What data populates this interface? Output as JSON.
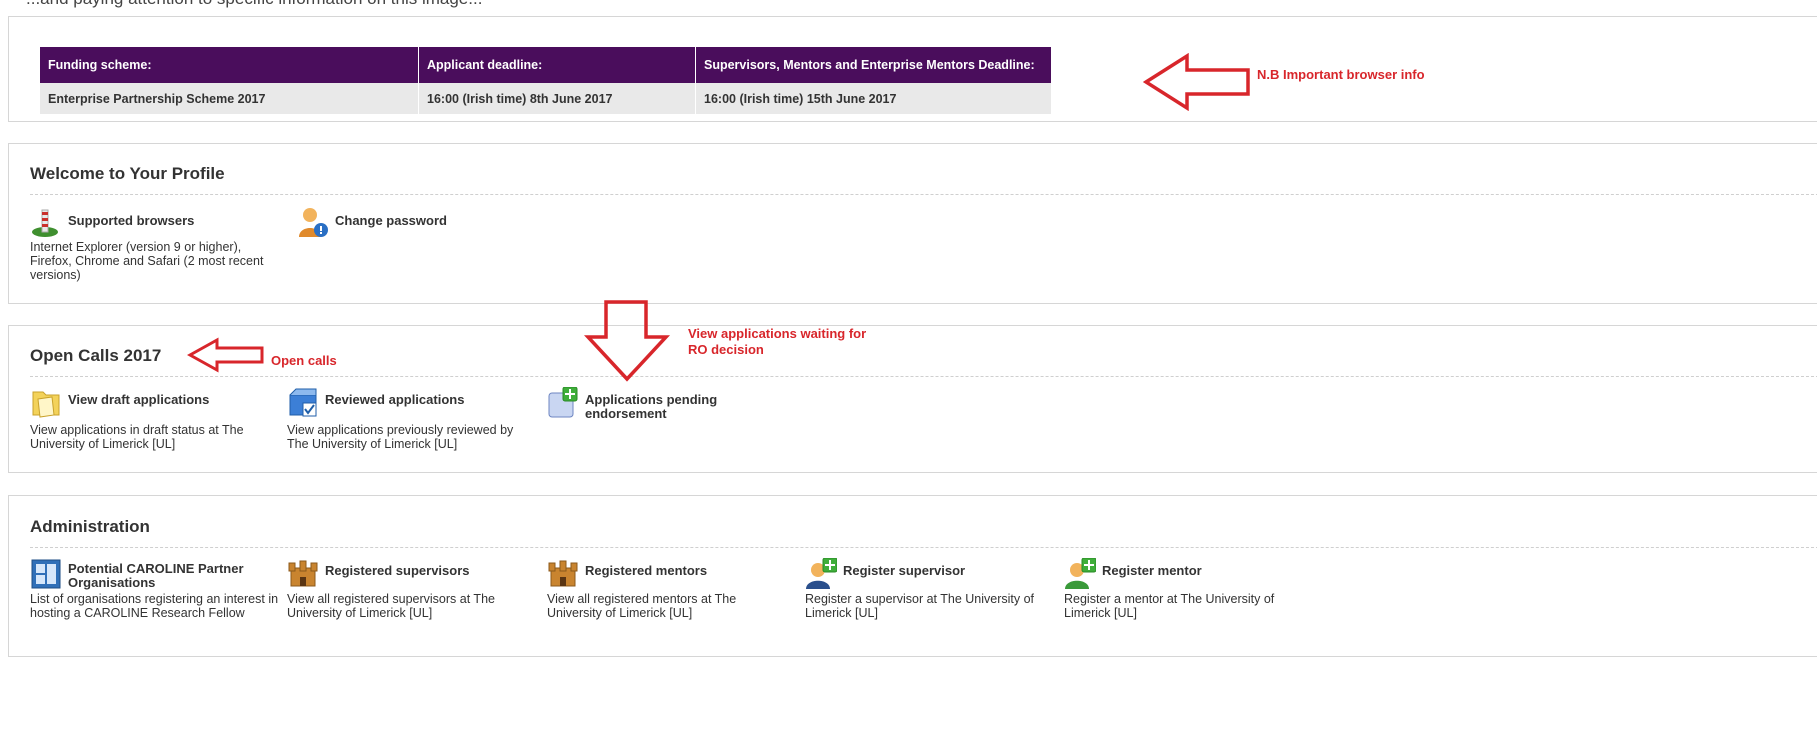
{
  "top_cut_text": "...and paying attention to specific information on this image...",
  "funding": {
    "headers": [
      "Funding scheme:",
      "Applicant deadline:",
      "Supervisors, Mentors and Enterprise Mentors Deadline:"
    ],
    "row": [
      "Enterprise Partnership Scheme 2017",
      "16:00 (Irish time) 8th June 2017",
      "16:00 (Irish time) 15th June 2017"
    ],
    "header_color": "#4a0d5c"
  },
  "annotations": {
    "browser_info": "N.B Important browser info",
    "open_calls": "Open calls",
    "pending_note": "View applications waiting for RO decision",
    "color": "#d8262b"
  },
  "profile": {
    "title": "Welcome to Your Profile",
    "items": [
      {
        "label": "Supported browsers",
        "desc": "Internet Explorer (version 9 or higher), Firefox, Chrome and Safari (2 most recent versions)",
        "icon": "browsers-icon"
      },
      {
        "label": "Change password",
        "desc": "",
        "icon": "user-password-icon"
      }
    ]
  },
  "open_calls": {
    "title": "Open Calls 2017",
    "items": [
      {
        "label": "View draft applications",
        "desc": "View applications in draft status at The University of Limerick [UL]",
        "icon": "folder-icon"
      },
      {
        "label": "Reviewed applications",
        "desc": "View applications previously reviewed by The University of Limerick [UL]",
        "icon": "reviewed-box-icon"
      },
      {
        "label": "Applications pending endorsement",
        "desc": "",
        "icon": "add-document-icon"
      }
    ]
  },
  "administration": {
    "title": "Administration",
    "items": [
      {
        "label": "Potential CAROLINE Partner Organisations",
        "desc": "List of organisations registering an interest in hosting a CAROLINE Research Fellow",
        "icon": "organisation-icon"
      },
      {
        "label": "Registered supervisors",
        "desc": "View all registered supervisors at The University of Limerick [UL]",
        "icon": "institution-icon"
      },
      {
        "label": "Registered mentors",
        "desc": "View all registered mentors at The University of Limerick [UL]",
        "icon": "institution-icon"
      },
      {
        "label": "Register supervisor",
        "desc": "Register a supervisor at The University of Limerick [UL]",
        "icon": "add-supervisor-icon"
      },
      {
        "label": "Register mentor",
        "desc": "Register a mentor at The University of Limerick [UL]",
        "icon": "add-mentor-icon"
      }
    ]
  }
}
